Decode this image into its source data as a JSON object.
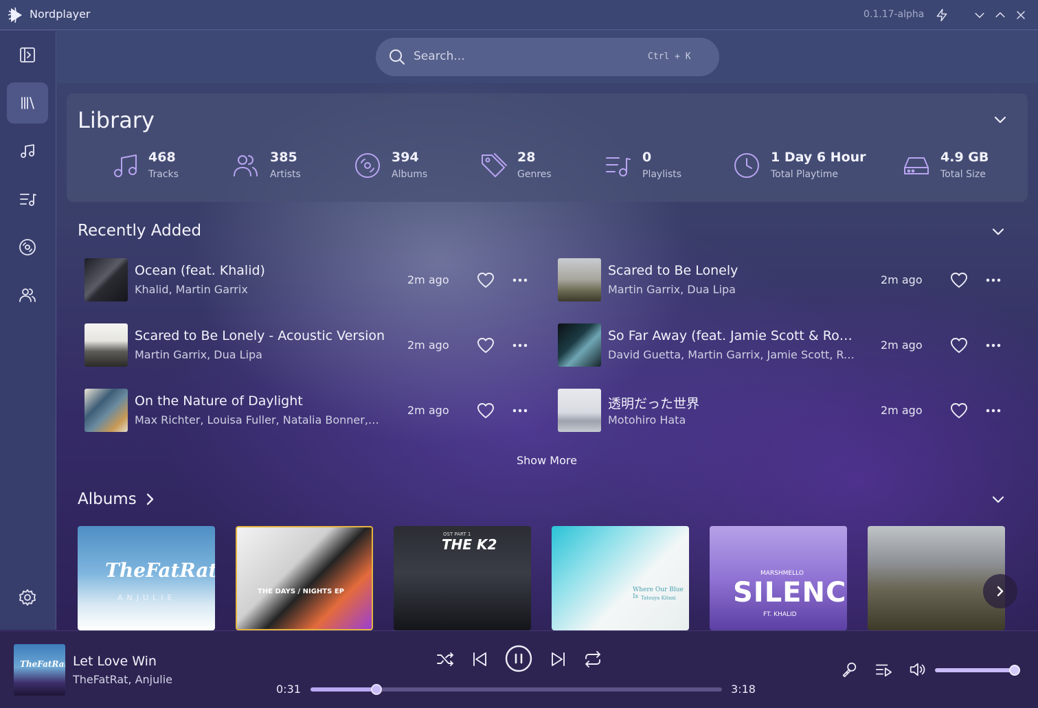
{
  "app": {
    "title": "Nordplayer",
    "version": "0.1.17-alpha"
  },
  "search": {
    "placeholder": "Search...",
    "shortcut": "Ctrl + K"
  },
  "sidebar": {
    "items": [
      {
        "name": "toggle-sidebar",
        "icon": "sidebar-toggle-icon"
      },
      {
        "name": "library",
        "icon": "library-icon",
        "active": true
      },
      {
        "name": "tracks",
        "icon": "music-note-icon"
      },
      {
        "name": "playlists",
        "icon": "playlist-icon"
      },
      {
        "name": "albums",
        "icon": "disc-icon"
      },
      {
        "name": "artists",
        "icon": "users-icon"
      }
    ],
    "settings_icon": "gear-icon"
  },
  "library": {
    "title": "Library",
    "stats": [
      {
        "value": "468",
        "label": "Tracks",
        "icon": "music-note-icon"
      },
      {
        "value": "385",
        "label": "Artists",
        "icon": "users-icon"
      },
      {
        "value": "394",
        "label": "Albums",
        "icon": "disc-icon"
      },
      {
        "value": "28",
        "label": "Genres",
        "icon": "tag-icon"
      },
      {
        "value": "0",
        "label": "Playlists",
        "icon": "playlist-icon"
      },
      {
        "value": "1 Day 6 Hour",
        "label": "Total Playtime",
        "icon": "clock-icon"
      },
      {
        "value": "4.9 GB",
        "label": "Total Size",
        "icon": "drive-icon"
      }
    ]
  },
  "recently_added": {
    "title": "Recently Added",
    "show_more": "Show More",
    "tracks": [
      {
        "title": "Ocean (feat. Khalid)",
        "artists": "Khalid, Martin Garrix",
        "added": "2m ago"
      },
      {
        "title": "Scared to Be Lonely",
        "artists": "Martin Garrix, Dua Lipa",
        "added": "2m ago"
      },
      {
        "title": "Scared to Be Lonely - Acoustic Version",
        "artists": "Martin Garrix, Dua Lipa",
        "added": "2m ago"
      },
      {
        "title": "So Far Away (feat. Jamie Scott & Romy ...",
        "artists": "David Guetta, Martin Garrix, Jamie Scott, Ro...",
        "added": "2m ago"
      },
      {
        "title": "On the Nature of Daylight",
        "artists": "Max Richter, Louisa Fuller, Natalia Bonner, Jo...",
        "added": "2m ago"
      },
      {
        "title": "透明だった世界",
        "artists": "Motohiro Hata",
        "added": "2m ago"
      }
    ]
  },
  "albums": {
    "title": "Albums",
    "covers": [
      {
        "line1": "TheFatRat",
        "line2": "ANJULIE"
      },
      {
        "line1": "THE DAYS / NIGHTS EP",
        "line2": ""
      },
      {
        "line1": "THE K2",
        "line2": "OST PART 1"
      },
      {
        "line1": "Where Our Blue Is",
        "line2": "Tatsuya Kitani"
      },
      {
        "line1": "SILENCE",
        "line2": "MARSHMELLO",
        "line3": "FT. KHALID"
      },
      {
        "line1": "",
        "line2": ""
      }
    ]
  },
  "player": {
    "title": "Let Love Win",
    "artists": "TheFatRat, Anjulie",
    "elapsed": "0:31",
    "duration": "3:18",
    "progress": 0.16,
    "volume": 1.0,
    "art_text": "TheFatRat"
  },
  "colors": {
    "accent": "#b9a5f2",
    "background": "#342a66"
  }
}
